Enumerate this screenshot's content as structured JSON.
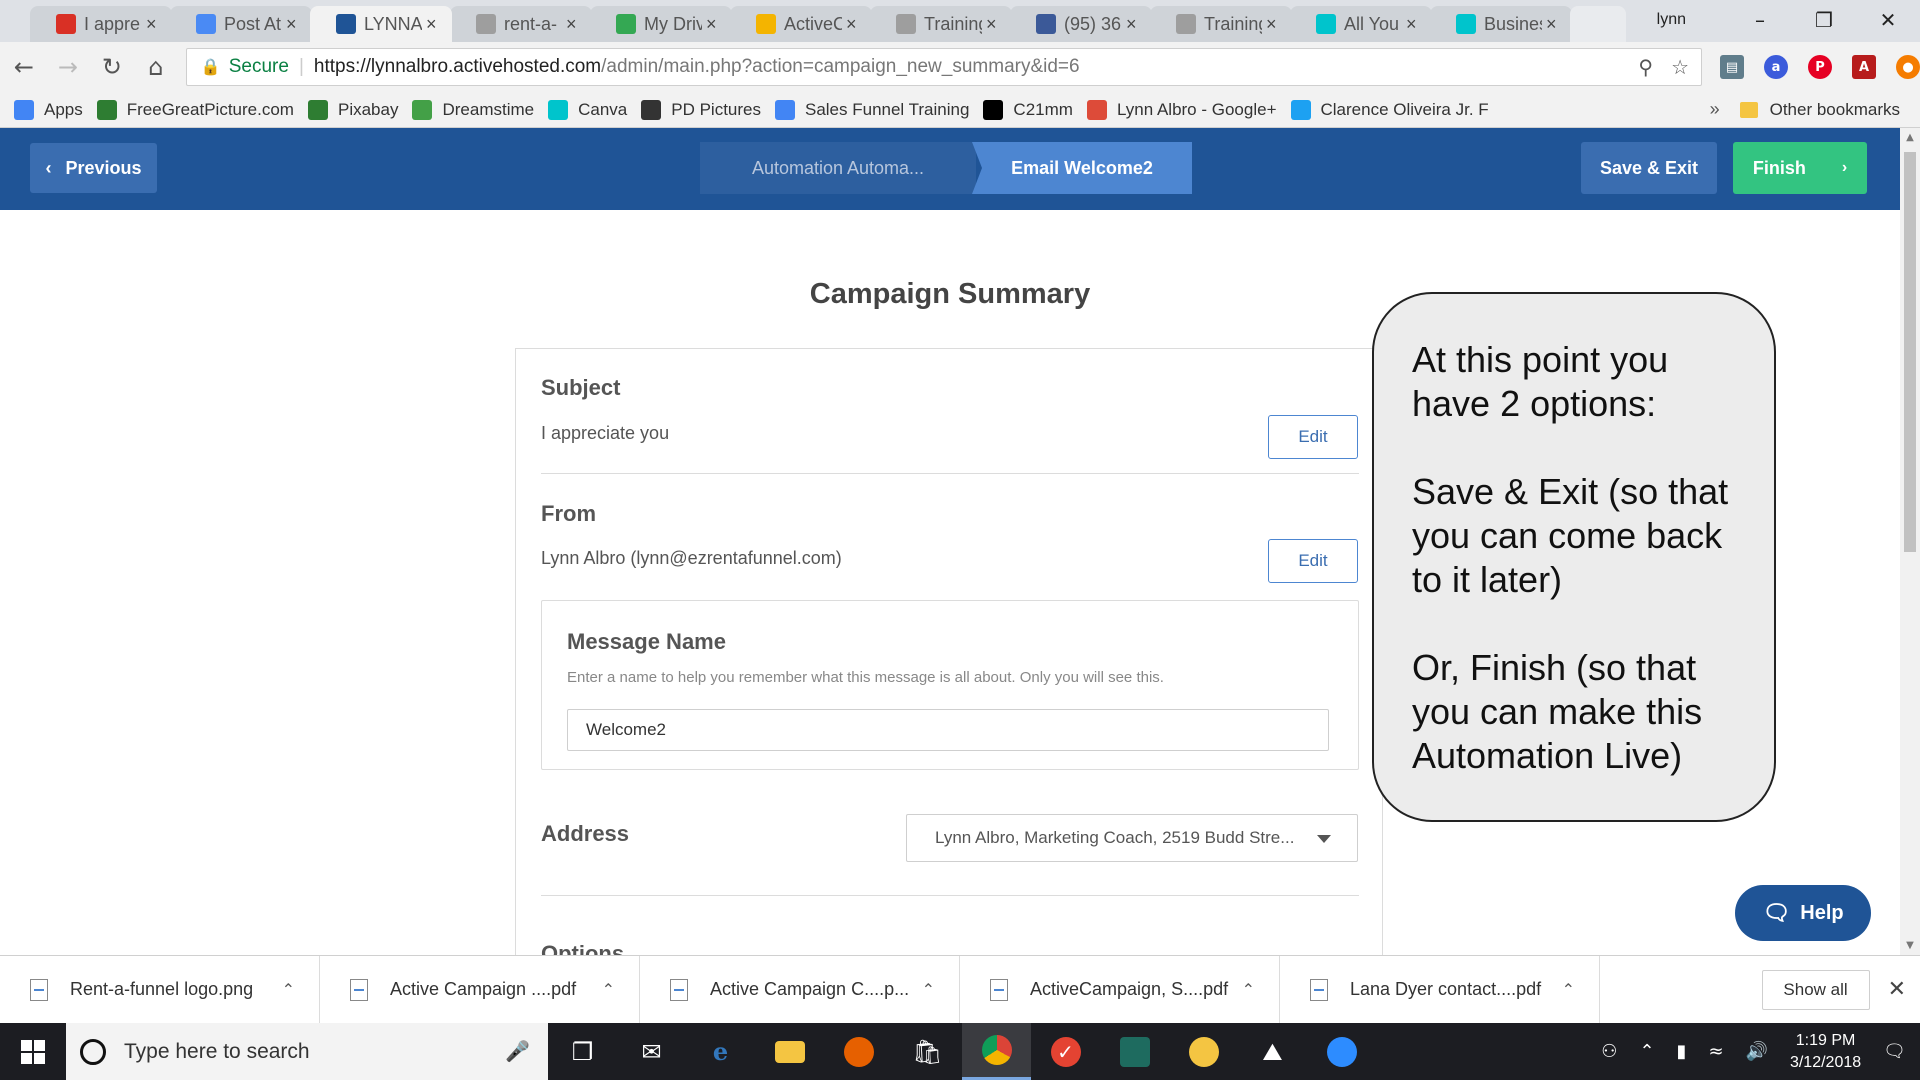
{
  "browser": {
    "tabs": [
      {
        "title": "I appre",
        "icon": "gmail-icon",
        "color": "#d93025"
      },
      {
        "title": "Post At",
        "icon": "post-icon",
        "color": "#4a8af4"
      },
      {
        "title": "LYNNA",
        "icon": "activecampaign-icon",
        "color": "#1f5496",
        "active": true
      },
      {
        "title": "rent-a-",
        "icon": "page-icon",
        "color": "#9e9e9e"
      },
      {
        "title": "My Driv",
        "icon": "drive-icon",
        "color": "#34a853"
      },
      {
        "title": "ActiveC",
        "icon": "slides-icon",
        "color": "#f4b400"
      },
      {
        "title": "Training",
        "icon": "page-icon",
        "color": "#9e9e9e"
      },
      {
        "title": "(95) 36",
        "icon": "facebook-icon",
        "color": "#3b5998"
      },
      {
        "title": "Training",
        "icon": "page-icon",
        "color": "#9e9e9e"
      },
      {
        "title": "All You",
        "icon": "canva-icon",
        "color": "#00c4cc"
      },
      {
        "title": "Busines",
        "icon": "canva-icon",
        "color": "#00c4cc"
      }
    ],
    "user": "lynn",
    "omnibox": {
      "secure_label": "Secure",
      "url_host": "https://lynnalbro.activehosted.com",
      "url_rest": "/admin/main.php?action=campaign_new_summary&id=6"
    },
    "bookmarks": [
      {
        "label": "Apps",
        "icon": "apps-grid-icon",
        "color": "#4285f4"
      },
      {
        "label": "FreeGreatPicture.com",
        "icon": "freegreatpicture-icon",
        "color": "#2e7d32"
      },
      {
        "label": "Pixabay",
        "icon": "pixabay-icon",
        "color": "#2e7d32"
      },
      {
        "label": "Dreamstime",
        "icon": "dreamstime-icon",
        "color": "#43a047"
      },
      {
        "label": "Canva",
        "icon": "canva-icon",
        "color": "#00c4cc"
      },
      {
        "label": "PD Pictures",
        "icon": "pdpictures-icon",
        "color": "#333333"
      },
      {
        "label": "Sales Funnel Training",
        "icon": "doc-icon",
        "color": "#4285f4"
      },
      {
        "label": "C21mm",
        "icon": "c21-icon",
        "color": "#000000"
      },
      {
        "label": "Lynn Albro - Google+",
        "icon": "google-plus-icon",
        "color": "#dd4b39"
      },
      {
        "label": "Clarence Oliveira Jr. F",
        "icon": "twitter-icon",
        "color": "#1da1f2"
      }
    ],
    "other_bookmarks": "Other bookmarks"
  },
  "header": {
    "previous_label": "Previous",
    "steps": [
      "Automation Automa...",
      "Email Welcome2"
    ],
    "save_exit_label": "Save & Exit",
    "finish_label": "Finish",
    "colors": {
      "bar": "#1f5496",
      "finish": "#33c481"
    }
  },
  "summary": {
    "title": "Campaign Summary",
    "subject": {
      "label": "Subject",
      "value": "I appreciate you",
      "edit": "Edit"
    },
    "from": {
      "label": "From",
      "value": "Lynn Albro (lynn@ezrentafunnel.com)",
      "edit": "Edit"
    },
    "message_name": {
      "label": "Message Name",
      "help": "Enter a name to help you remember what this message is all about. Only you will see this.",
      "value": "Welcome2"
    },
    "address": {
      "label": "Address",
      "selected": "Lynn Albro, Marketing Coach, 2519 Budd Stre..."
    },
    "options": {
      "label": "Options"
    }
  },
  "callout": {
    "paragraphs": [
      "At this point you have 2 options:",
      "Save & Exit (so that you can come back to it later)",
      "Or, Finish (so that you can make this Automation Live)"
    ]
  },
  "help_label": "Help",
  "downloads": {
    "items": [
      "Rent-a-funnel logo.png",
      "Active Campaign ....pdf",
      "Active Campaign C....p...",
      "ActiveCampaign, S....pdf",
      "Lana Dyer contact....pdf"
    ],
    "show_all": "Show all"
  },
  "taskbar": {
    "search_placeholder": "Type here to search",
    "time": "1:19 PM",
    "date": "3/12/2018"
  }
}
